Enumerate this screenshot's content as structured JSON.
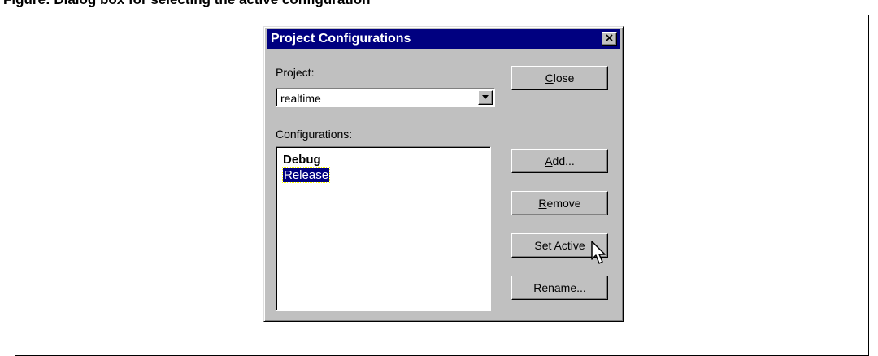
{
  "caption": {
    "text": "Figure: Dialog box for selecting the active configuration"
  },
  "dialog": {
    "title": "Project Configurations",
    "close_glyph": "×",
    "project_label": "Project:",
    "project_value": "realtime",
    "configurations_label": "Configurations:",
    "configurations": [
      {
        "label": "Debug",
        "active": true,
        "selected": false
      },
      {
        "label": "Release",
        "active": false,
        "selected": true
      }
    ],
    "buttons": {
      "close": {
        "mnemonic": "C",
        "rest": "lose"
      },
      "add": {
        "mnemonic": "A",
        "rest": "dd..."
      },
      "remove": {
        "mnemonic": "R",
        "rest": "emove"
      },
      "set_active": {
        "label": "Set Active"
      },
      "rename": {
        "mnemonic": "R",
        "rest": "ename..."
      }
    }
  },
  "icons": {
    "close": "close-icon",
    "dropdown": "chevron-down-icon",
    "cursor": "arrow-cursor-icon"
  }
}
